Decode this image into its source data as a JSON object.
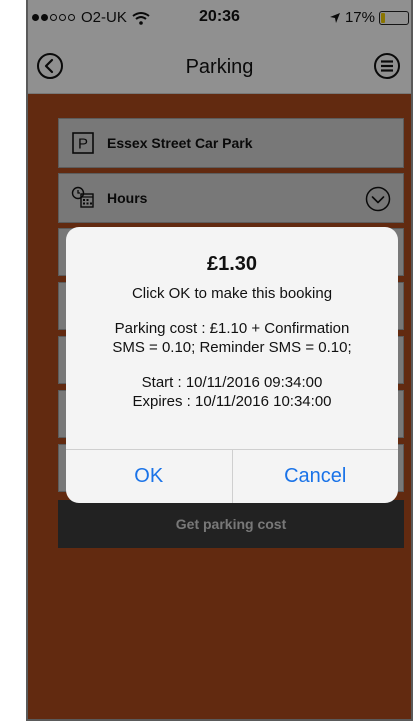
{
  "status_bar": {
    "carrier": "O2-UK",
    "time": "20:36",
    "battery": "17%",
    "battery_level": 0.17,
    "icons": [
      "signal-dots-icon",
      "wifi-icon",
      "location-arrow-icon",
      "battery-icon"
    ]
  },
  "nav": {
    "title": "Parking",
    "back_icon": "back-circle-icon",
    "menu_icon": "menu-circle-icon"
  },
  "form": {
    "car_park": {
      "label": "Essex Street Car Park",
      "icon": "parking-icon"
    },
    "hours": {
      "label": "Hours",
      "icon": "calendar-clock-icon",
      "chevron": "chevron-down-circle-icon"
    },
    "get_cost_label": "Get parking cost"
  },
  "alert": {
    "title": "£1.30",
    "line1": "Click OK to make this booking",
    "line2": "Parking cost : £1.10 + Confirmation",
    "line3": "SMS = 0.10; Reminder SMS = 0.10;",
    "line4": "Start : 10/11/2016 09:34:00",
    "line5": "Expires : 10/11/2016 10:34:00",
    "ok_label": "OK",
    "cancel_label": "Cancel"
  },
  "colors": {
    "background": "#a4461c",
    "header": "#f0f0f0",
    "row": "#c9c9c9",
    "button_dark": "#3a3a3a",
    "alert_button": "#1a73e8"
  }
}
